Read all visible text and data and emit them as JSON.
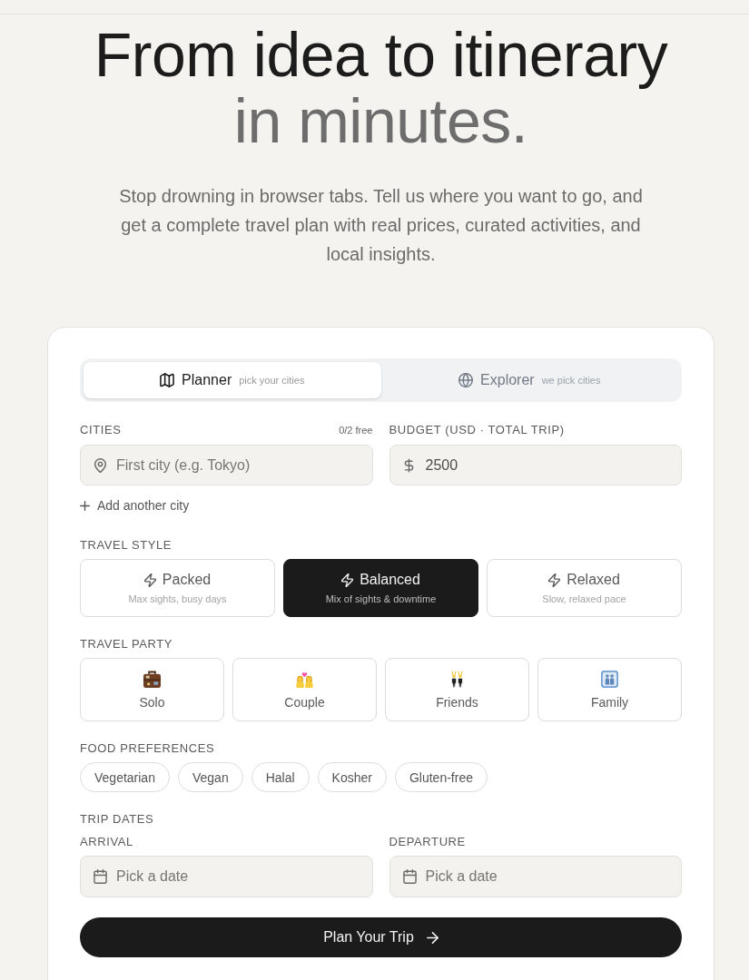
{
  "hero": {
    "title": "From idea to itinerary",
    "title_accent": "in minutes.",
    "subtitle": "Stop drowning in browser tabs. Tell us where you want to go, and get a complete travel plan with real prices, curated activities, and local insights."
  },
  "planner": {
    "modes": [
      {
        "label": "Planner",
        "hint": "pick your cities",
        "selected": true
      },
      {
        "label": "Explorer",
        "hint": "we pick cities",
        "selected": false
      }
    ],
    "cities": {
      "label": "CITIES",
      "quota": "0/2 free",
      "placeholder": "First city (e.g. Tokyo)",
      "add_label": "Add another city"
    },
    "budget": {
      "label": "BUDGET (USD · TOTAL TRIP)",
      "value": "2500"
    },
    "travel_style": {
      "label": "TRAVEL STYLE",
      "options": [
        {
          "label": "Packed",
          "hint": "Max sights, busy days",
          "selected": false
        },
        {
          "label": "Balanced",
          "hint": "Mix of sights & downtime",
          "selected": true
        },
        {
          "label": "Relaxed",
          "hint": "Slow, relaxed pace",
          "selected": false
        }
      ]
    },
    "travel_party": {
      "label": "TRAVEL PARTY",
      "options": [
        {
          "label": "Solo",
          "selected": false
        },
        {
          "label": "Couple",
          "selected": false
        },
        {
          "label": "Friends",
          "selected": false
        },
        {
          "label": "Family",
          "selected": false
        }
      ]
    },
    "food_preferences": {
      "label": "FOOD PREFERENCES",
      "options": [
        {
          "label": "Vegetarian",
          "selected": false
        },
        {
          "label": "Vegan",
          "selected": false
        },
        {
          "label": "Halal",
          "selected": false
        },
        {
          "label": "Kosher",
          "selected": false
        },
        {
          "label": "Gluten-free",
          "selected": false
        }
      ]
    },
    "trip_dates": {
      "label": "TRIP DATES",
      "arrival": {
        "label": "ARRIVAL",
        "placeholder": "Pick a date"
      },
      "departure": {
        "label": "DEPARTURE",
        "placeholder": "Pick a date"
      }
    },
    "submit": {
      "label": "Plan Your Trip"
    }
  }
}
